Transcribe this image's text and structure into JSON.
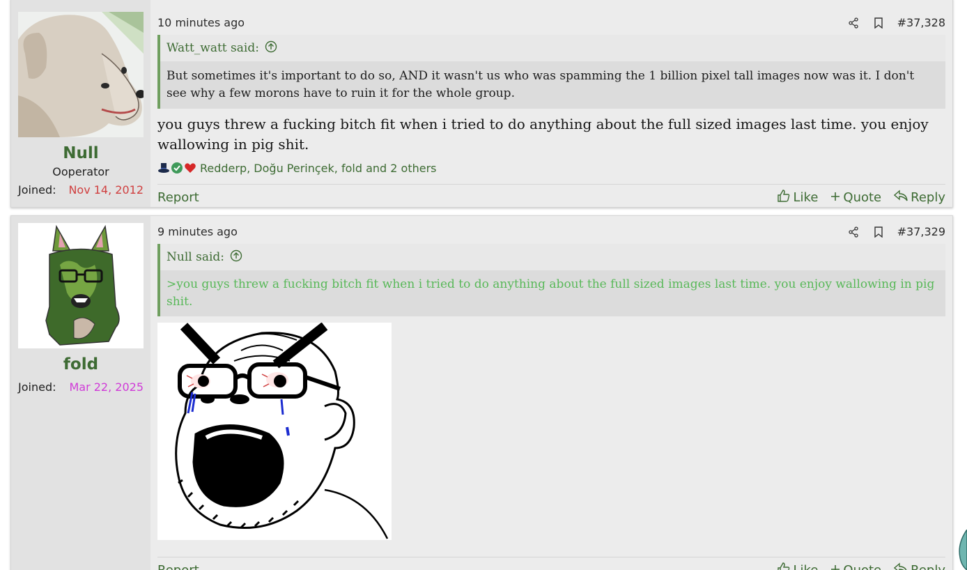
{
  "posts": [
    {
      "timestamp": "10 minutes ago",
      "post_number": "#37,328",
      "user": {
        "name": "Null",
        "title": "Ooperator",
        "joined_label": "Joined:",
        "joined_date": "Nov 14, 2012",
        "joined_color": "#d04040"
      },
      "quote": {
        "author": "Watt_watt said:",
        "text": "But sometimes it's important to do so, AND it wasn't us who was spamming the 1 billion pixel tall images now was it. I don't see why a few morons have to ruin it for the whole group."
      },
      "message": "you guys threw a fucking bitch fit when i tried to do anything about the full sized images last time. you enjoy wallowing in pig shit.",
      "reactions": {
        "icons": [
          "top-hat-icon",
          "check-icon",
          "heart-icon"
        ],
        "text": "Redderp, Doğu Perinçek, fold and 2 others"
      },
      "actions": {
        "report": "Report",
        "like": "Like",
        "quote": "Quote",
        "reply": "Reply"
      }
    },
    {
      "timestamp": "9 minutes ago",
      "post_number": "#37,329",
      "user": {
        "name": "fold",
        "joined_label": "Joined:",
        "joined_date": "Mar 22, 2025",
        "joined_color": "#d03bd8"
      },
      "quote": {
        "author": "Null said:",
        "text": ">you guys threw a fucking bitch fit when i tried to do anything about the full sized images last time. you enjoy wallowing in pig shit."
      },
      "attachment": "crying-soyjak-image",
      "actions": {
        "report": "Report",
        "like": "Like",
        "quote": "Quote",
        "reply": "Reply"
      }
    }
  ],
  "colors": {
    "accent_green": "#3d6b33",
    "quote_border": "#6f9f5f",
    "greentext": "#58b858"
  }
}
